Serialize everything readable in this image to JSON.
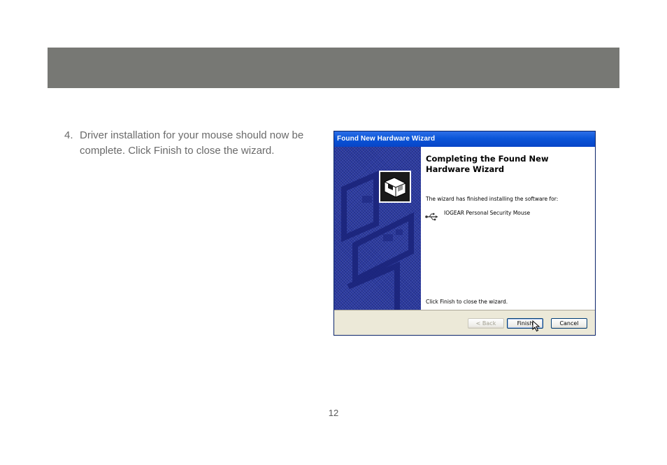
{
  "step": {
    "number": "4.",
    "text": "Driver installation for your mouse should now be complete.  Click Finish to close the wizard."
  },
  "wizard": {
    "title": "Found New Hardware Wizard",
    "heading": "Completing the Found New Hardware Wizard",
    "intro": "The wizard has finished installing the software for:",
    "device_name": "IOGEAR Personal Security Mouse",
    "footer_text": "Click Finish to close the wizard.",
    "buttons": {
      "back": "< Back",
      "finish": "Finish",
      "cancel": "Cancel"
    },
    "icons": [
      "hardware-wizard-icon",
      "usb-icon",
      "mouse-cursor-icon"
    ]
  },
  "page_number": "12",
  "colors": {
    "header_band": "#777874",
    "title_bar": "#0a55d8",
    "side_panel": "#2b3aa0",
    "button_bar": "#ece9d8"
  }
}
